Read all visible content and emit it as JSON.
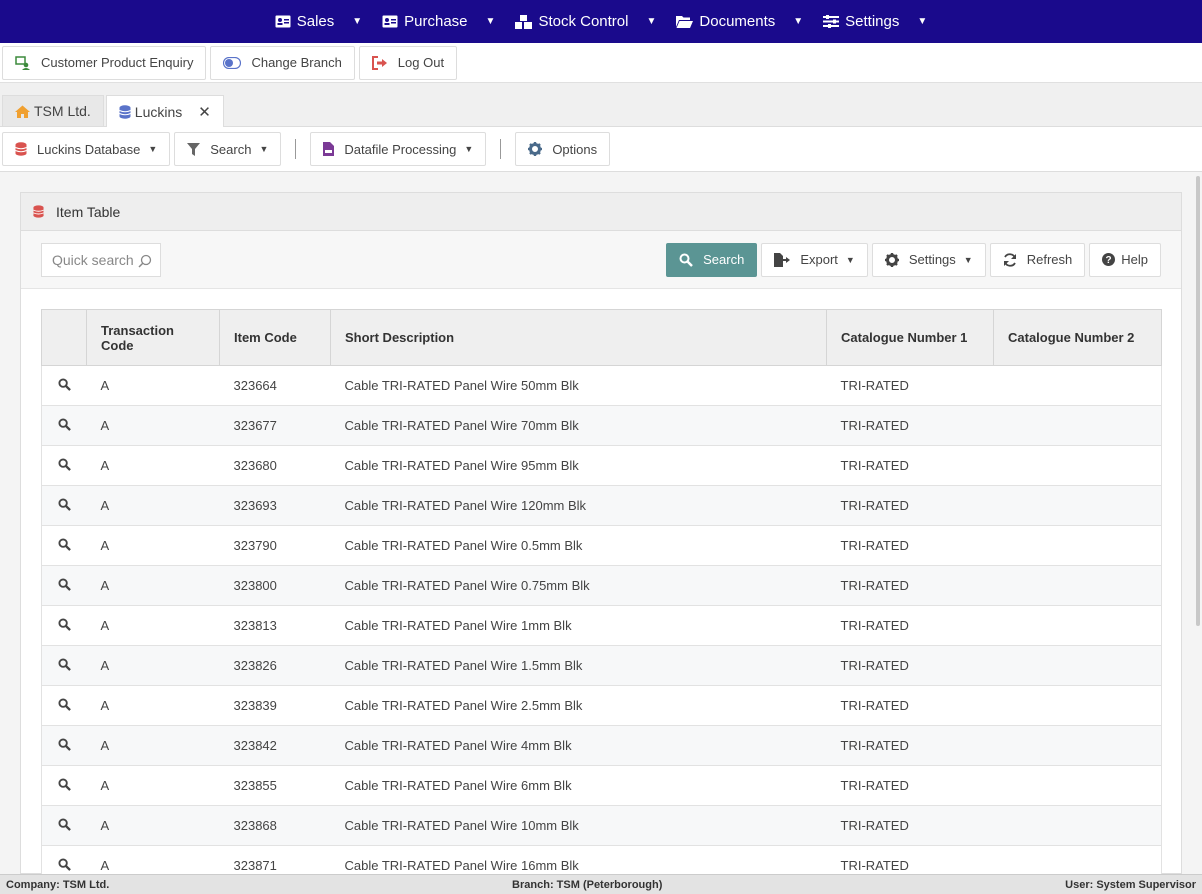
{
  "topnav": {
    "items": [
      {
        "label": "Sales"
      },
      {
        "label": "Purchase"
      },
      {
        "label": "Stock Control"
      },
      {
        "label": "Documents"
      },
      {
        "label": "Settings"
      }
    ]
  },
  "actionbar": {
    "customer_enquiry": "Customer Product Enquiry",
    "change_branch": "Change Branch",
    "log_out": "Log Out"
  },
  "tabs": [
    {
      "label": "TSM Ltd."
    },
    {
      "label": "Luckins",
      "close": "✕"
    }
  ],
  "toolbar": {
    "database": "Luckins Database",
    "search": "Search",
    "datafile": "Datafile Processing",
    "options": "Options"
  },
  "panel": {
    "title": "Item Table",
    "quick_search_placeholder": "Quick search",
    "search_button": "Search",
    "export_button": "Export",
    "settings_button": "Settings",
    "refresh_button": "Refresh",
    "help_button": "Help"
  },
  "table": {
    "columns": [
      "Transaction Code",
      "Item Code",
      "Short Description",
      "Catalogue Number 1",
      "Catalogue Number 2"
    ],
    "rows": [
      {
        "code": "A",
        "item": "323664",
        "desc": "Cable TRI-RATED Panel Wire 50mm Blk",
        "cat1": "TRI-RATED",
        "cat2": ""
      },
      {
        "code": "A",
        "item": "323677",
        "desc": "Cable TRI-RATED Panel Wire 70mm Blk",
        "cat1": "TRI-RATED",
        "cat2": ""
      },
      {
        "code": "A",
        "item": "323680",
        "desc": "Cable TRI-RATED Panel Wire 95mm Blk",
        "cat1": "TRI-RATED",
        "cat2": ""
      },
      {
        "code": "A",
        "item": "323693",
        "desc": "Cable TRI-RATED Panel Wire 120mm Blk",
        "cat1": "TRI-RATED",
        "cat2": ""
      },
      {
        "code": "A",
        "item": "323790",
        "desc": "Cable TRI-RATED Panel Wire 0.5mm Blk",
        "cat1": "TRI-RATED",
        "cat2": ""
      },
      {
        "code": "A",
        "item": "323800",
        "desc": "Cable TRI-RATED Panel Wire 0.75mm Blk",
        "cat1": "TRI-RATED",
        "cat2": ""
      },
      {
        "code": "A",
        "item": "323813",
        "desc": "Cable TRI-RATED Panel Wire 1mm Blk",
        "cat1": "TRI-RATED",
        "cat2": ""
      },
      {
        "code": "A",
        "item": "323826",
        "desc": "Cable TRI-RATED Panel Wire 1.5mm Blk",
        "cat1": "TRI-RATED",
        "cat2": ""
      },
      {
        "code": "A",
        "item": "323839",
        "desc": "Cable TRI-RATED Panel Wire 2.5mm Blk",
        "cat1": "TRI-RATED",
        "cat2": ""
      },
      {
        "code": "A",
        "item": "323842",
        "desc": "Cable TRI-RATED Panel Wire 4mm Blk",
        "cat1": "TRI-RATED",
        "cat2": ""
      },
      {
        "code": "A",
        "item": "323855",
        "desc": "Cable TRI-RATED Panel Wire 6mm Blk",
        "cat1": "TRI-RATED",
        "cat2": ""
      },
      {
        "code": "A",
        "item": "323868",
        "desc": "Cable TRI-RATED Panel Wire 10mm Blk",
        "cat1": "TRI-RATED",
        "cat2": ""
      },
      {
        "code": "A",
        "item": "323871",
        "desc": "Cable TRI-RATED Panel Wire 16mm Blk",
        "cat1": "TRI-RATED",
        "cat2": ""
      }
    ]
  },
  "status": {
    "company": "Company: TSM Ltd.",
    "branch": "Branch: TSM (Peterborough)",
    "user": "User: System Supervisor"
  },
  "colors": {
    "nav_bg": "#1a0a8c",
    "search_button": "#5b9594",
    "db_icon": "#d9534f"
  }
}
